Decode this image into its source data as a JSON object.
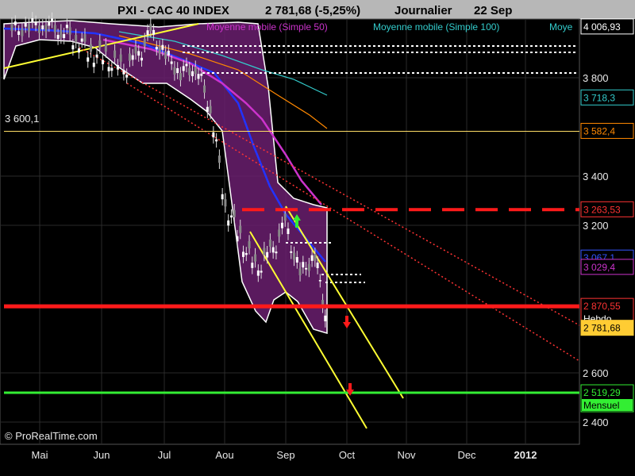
{
  "header": {
    "title": "PXI - CAC 40 INDEX",
    "price": "2 781,68 (-5,25%)",
    "period": "Journalier",
    "date": "22 Sep"
  },
  "legend": [
    {
      "label": "Moyenne mobile (Simple 50)",
      "color": "#cc33cc"
    },
    {
      "label": "Moyenne mobile (Simple 100)",
      "color": "#33cccc"
    },
    {
      "label": "Moye",
      "color": "#33cccc"
    }
  ],
  "watermark": "© ProRealTime.com",
  "left_label": "3 600,1",
  "colors": {
    "background": "#000000",
    "title_bar": "#b7b7b7",
    "bollinger_fill": "#6a1f6e",
    "resistance_red": "#ff1a1a",
    "support_green": "#33ee33",
    "channel_yellow": "#ffff33",
    "ma20": "#2233ff",
    "ma50": "#cc33cc",
    "ma100": "#33cccc",
    "ma200": "#ff8800"
  },
  "chart_data": {
    "type": "candlestick",
    "title": "PXI - CAC 40 INDEX",
    "x_tick_labels": [
      "Mai",
      "Jun",
      "Jul",
      "Aou",
      "Sep",
      "Oct",
      "Nov",
      "Dec",
      "2012"
    ],
    "y_tick_labels": [
      "2 400",
      "2 600",
      "3 200",
      "3 400",
      "3 800"
    ],
    "ylim": [
      2380,
      4060
    ],
    "grid": true,
    "price_tags": [
      {
        "text": "4 006,93",
        "value": 4006.93,
        "bg": "#000000",
        "fg": "#ffffff",
        "border": "#ffffff"
      },
      {
        "text": "3 718,3",
        "value": 3718.3,
        "bg": "#000000",
        "fg": "#33cccc",
        "border": "#33cccc"
      },
      {
        "text": "3 582,4",
        "value": 3582.4,
        "bg": "#000000",
        "fg": "#ff8800",
        "border": "#ff8800"
      },
      {
        "text": "3 263,53",
        "value": 3263.53,
        "bg": "#000000",
        "fg": "#ff3333",
        "border": "#ff3333"
      },
      {
        "text": "3 067,1",
        "value": 3067.1,
        "bg": "#000000",
        "fg": "#3355ff",
        "border": "#3355ff"
      },
      {
        "text": "3 029,4",
        "value": 3029.4,
        "bg": "#000000",
        "fg": "#cc33cc",
        "border": "#cc33cc"
      },
      {
        "text": "2 870,55",
        "value": 2870.55,
        "bg": "#000000",
        "fg": "#ff3333",
        "border": "#ff3333",
        "note": "Hebdo"
      },
      {
        "text": "2 781,68",
        "value": 2781.68,
        "bg": "#ffcc33",
        "fg": "#000000",
        "border": "#ffcc33"
      },
      {
        "text": "2 519,29",
        "value": 2519.29,
        "bg": "#000000",
        "fg": "#33ee33",
        "border": "#33ee33",
        "note": "Mensuel"
      }
    ],
    "horizontal_lines": [
      {
        "name": "resistance-3600",
        "value": 3582.4,
        "color": "#ffdd66",
        "width": 1
      },
      {
        "name": "resistance-3263",
        "value": 3263.53,
        "color": "#ff1a1a",
        "width": 4,
        "dash": true
      },
      {
        "name": "support-hebdo",
        "value": 2870.55,
        "color": "#ff1a1a",
        "width": 5
      },
      {
        "name": "support-mensuel",
        "value": 2519.29,
        "color": "#33ee33",
        "width": 3
      }
    ],
    "series": [
      {
        "type": "candles_summary",
        "points": [
          [
            "2011-04-27",
            3990
          ],
          [
            "2011-05-05",
            4010
          ],
          [
            "2011-05-13",
            4020
          ],
          [
            "2011-05-20",
            3995
          ],
          [
            "2011-05-27",
            3960
          ],
          [
            "2011-06-03",
            3900
          ],
          [
            "2011-06-10",
            3880
          ],
          [
            "2011-06-17",
            3830
          ],
          [
            "2011-06-24",
            3870
          ],
          [
            "2011-07-01",
            3980
          ],
          [
            "2011-07-08",
            3890
          ],
          [
            "2011-07-15",
            3820
          ],
          [
            "2011-07-22",
            3850
          ],
          [
            "2011-07-29",
            3680
          ],
          [
            "2011-08-05",
            3280
          ],
          [
            "2011-08-12",
            3150
          ],
          [
            "2011-08-19",
            3020
          ],
          [
            "2011-08-26",
            3080
          ],
          [
            "2011-09-02",
            3200
          ],
          [
            "2011-09-09",
            3000
          ],
          [
            "2011-09-16",
            3080
          ],
          [
            "2011-09-22",
            2781.68
          ]
        ]
      }
    ]
  }
}
